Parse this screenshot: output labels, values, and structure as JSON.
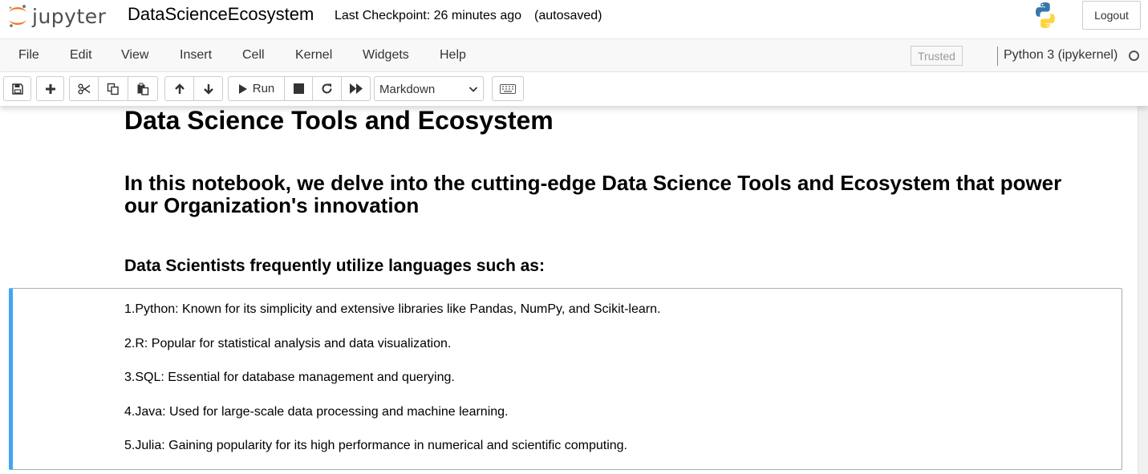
{
  "header": {
    "logo_text": "jupyter",
    "notebook_name": "DataScienceEcosystem",
    "checkpoint": "Last Checkpoint: 26 minutes ago",
    "autosave": "(autosaved)",
    "logout_label": "Logout"
  },
  "menubar": {
    "items": [
      "File",
      "Edit",
      "View",
      "Insert",
      "Cell",
      "Kernel",
      "Widgets",
      "Help"
    ],
    "trusted_label": "Trusted",
    "kernel_name": "Python 3 (ipykernel)"
  },
  "toolbar": {
    "run_label": "Run",
    "cell_type": "Markdown",
    "buttons": [
      "save-icon",
      "plus-icon",
      "scissors-icon",
      "copy-icon",
      "paste-icon",
      "arrow-up-icon",
      "arrow-down-icon",
      "play-icon",
      "stop-icon",
      "restart-icon",
      "fast-forward-icon",
      "keyboard-icon"
    ]
  },
  "notebook": {
    "title": "Data Science Tools and Ecosystem",
    "intro": "In this notebook, we delve into the cutting-edge Data Science Tools and Ecosystem that power our Organization's innovation",
    "languages_heading": "Data Scientists frequently utilize languages such as:",
    "languages": [
      "1.Python: Known for its simplicity and extensive libraries like Pandas, NumPy, and Scikit-learn.",
      "2.R: Popular for statistical analysis and data visualization.",
      "3.SQL: Essential for database management and querying.",
      "4.Java: Used for large-scale data processing and machine learning.",
      "5.Julia: Gaining popularity for its high performance in numerical and scientific computing."
    ]
  },
  "colors": {
    "selected_cell_accent": "#42a5f5",
    "jupyter_orange": "#f37726",
    "python_blue": "#3776ab",
    "python_yellow": "#ffd43b"
  }
}
